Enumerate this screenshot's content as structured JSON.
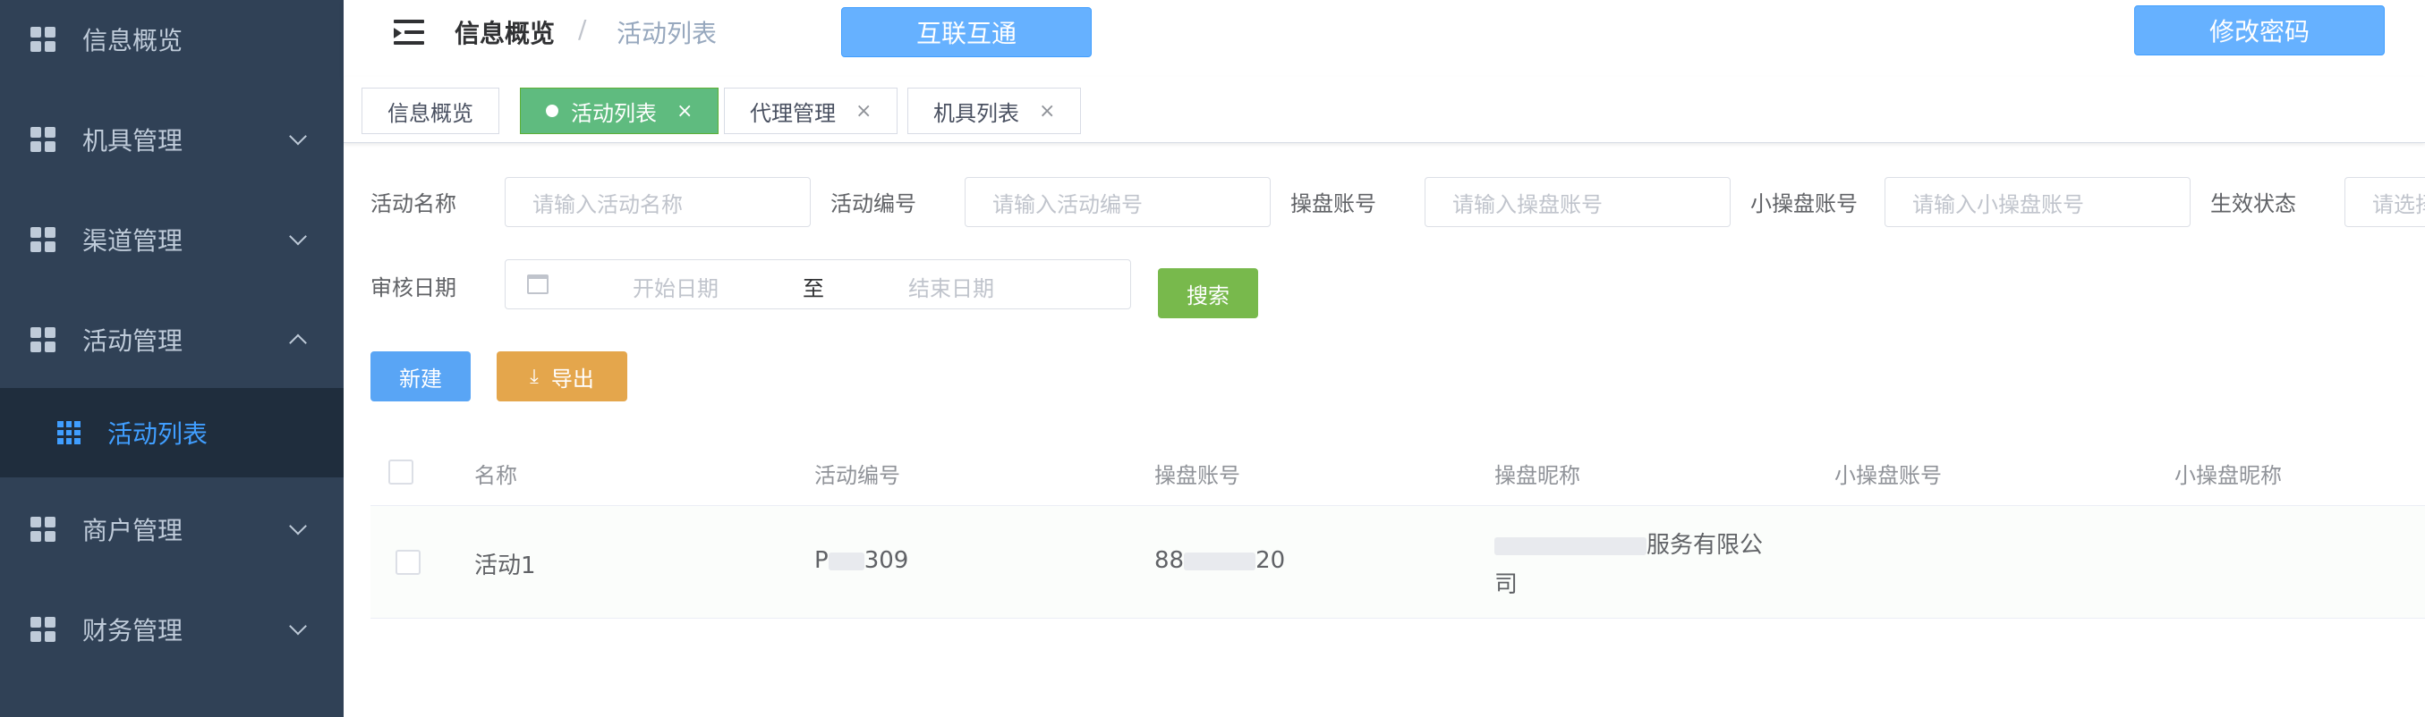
{
  "sidebar": {
    "items": [
      {
        "label": "信息概览"
      },
      {
        "label": "机具管理"
      },
      {
        "label": "渠道管理"
      },
      {
        "label": "活动管理"
      },
      {
        "label": "商户管理"
      },
      {
        "label": "财务管理"
      }
    ],
    "submenu": {
      "label": "活动列表"
    }
  },
  "navbar": {
    "breadcrumb_first": "信息概览",
    "breadcrumb_sep": "/",
    "breadcrumb_second": "活动列表",
    "hulian_button": "互联互通",
    "change_password_button": "修改密码"
  },
  "tags": [
    {
      "label": "信息概览"
    },
    {
      "label": "活动列表"
    },
    {
      "label": "代理管理"
    },
    {
      "label": "机具列表"
    }
  ],
  "tag_close": "×",
  "filters": {
    "activity_name_label": "活动名称",
    "activity_name_placeholder": "请输入活动名称",
    "activity_no_label": "活动编号",
    "activity_no_placeholder": "请输入活动编号",
    "operator_account_label": "操盘账号",
    "operator_account_placeholder": "请输入操盘账号",
    "small_operator_label": "小操盘账号",
    "small_operator_placeholder": "请输入小操盘账号",
    "status_label": "生效状态",
    "status_placeholder": "请选择",
    "audit_date_label": "审核日期",
    "start_date_placeholder": "开始日期",
    "date_to": "至",
    "end_date_placeholder": "结束日期",
    "search_button": "搜索"
  },
  "actions": {
    "new_button": "新建",
    "export_icon": "⤓",
    "export_button": "导出"
  },
  "table": {
    "columns": [
      "名称",
      "活动编号",
      "操盘账号",
      "操盘昵称",
      "小操盘账号",
      "小操盘昵称"
    ],
    "rows": [
      {
        "name": "活动1",
        "activity_no_start": "P",
        "activity_no_end": "309",
        "operator_account_start": "88",
        "operator_account_end": "20",
        "nickname_line1": "服务有限公",
        "nickname_line2": "司"
      }
    ]
  }
}
